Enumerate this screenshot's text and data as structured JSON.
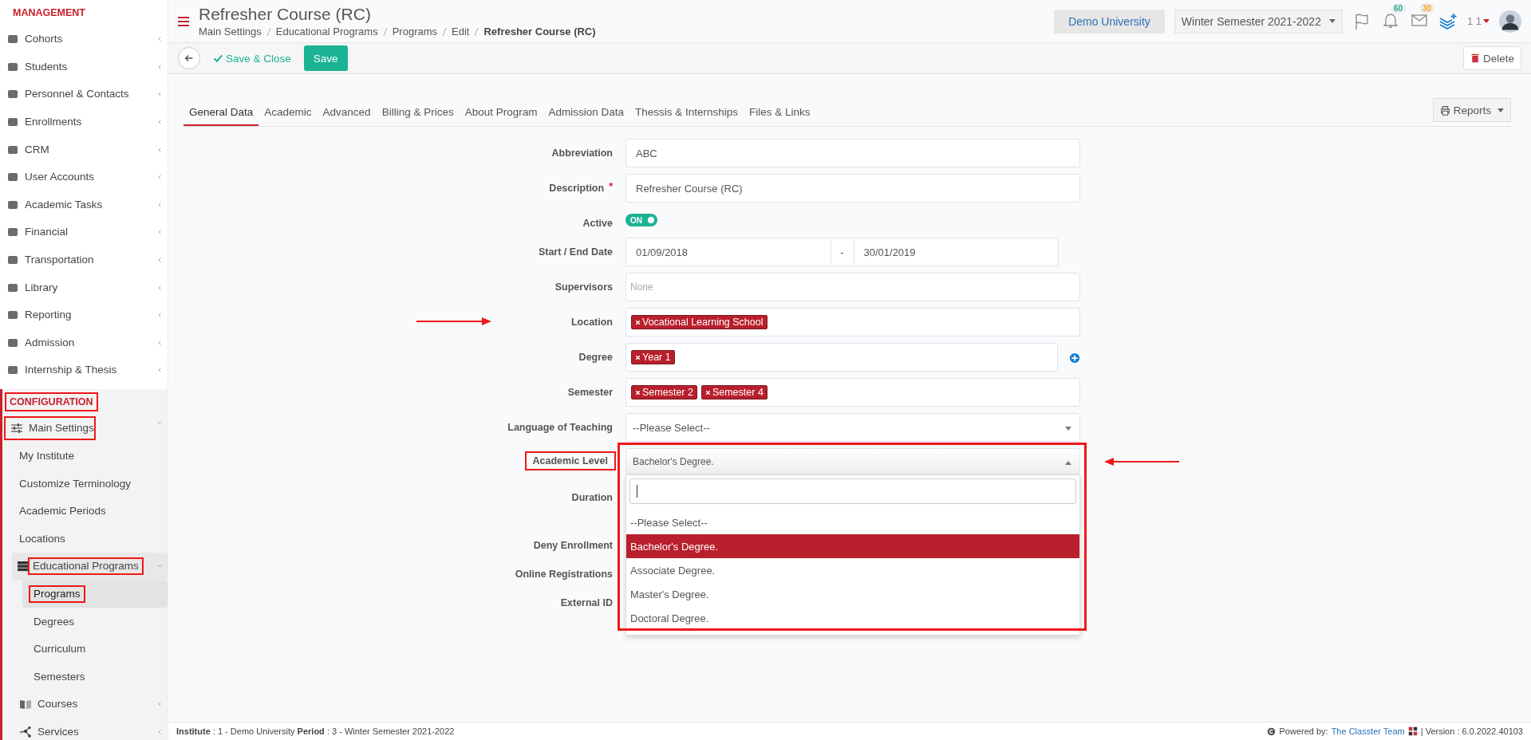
{
  "sidebar": {
    "sections": [
      {
        "title": "MANAGEMENT",
        "highlighted": false,
        "items": [
          {
            "label": "Cohorts",
            "highlighted": false,
            "selected": false,
            "expanded": false
          },
          {
            "label": "Students",
            "highlighted": false,
            "selected": false,
            "expanded": false
          },
          {
            "label": "Personnel & Contacts",
            "highlighted": false,
            "selected": false,
            "expanded": false
          },
          {
            "label": "Enrollments",
            "highlighted": false,
            "selected": false,
            "expanded": false
          },
          {
            "label": "CRM",
            "highlighted": false,
            "selected": false,
            "expanded": false
          },
          {
            "label": "User Accounts",
            "highlighted": false,
            "selected": false,
            "expanded": false
          },
          {
            "label": "Academic Tasks",
            "highlighted": false,
            "selected": false,
            "expanded": false
          },
          {
            "label": "Financial",
            "highlighted": false,
            "selected": false,
            "expanded": false
          },
          {
            "label": "Transportation",
            "highlighted": false,
            "selected": false,
            "expanded": false
          },
          {
            "label": "Library",
            "highlighted": false,
            "selected": false,
            "expanded": false
          },
          {
            "label": "Reporting",
            "highlighted": false,
            "selected": false,
            "expanded": false
          },
          {
            "label": "Admission",
            "highlighted": false,
            "selected": false,
            "expanded": false
          },
          {
            "label": "Internship & Thesis",
            "highlighted": false,
            "selected": false,
            "expanded": false
          }
        ]
      },
      {
        "title": "CONFIGURATION",
        "highlighted": true,
        "items": [
          {
            "label": "Main Settings",
            "highlighted": true,
            "selected": false,
            "expanded": true,
            "children": [
              {
                "label": "My Institute",
                "highlighted": false,
                "selected": false
              },
              {
                "label": "Customize Terminology",
                "highlighted": false,
                "selected": false
              },
              {
                "label": "Academic Periods",
                "highlighted": false,
                "selected": false
              },
              {
                "label": "Locations",
                "highlighted": false,
                "selected": false
              },
              {
                "label": "Educational Programs",
                "highlighted": true,
                "selected": false,
                "expanded": true,
                "children": [
                  {
                    "label": "Programs",
                    "highlighted": true,
                    "selected": true
                  },
                  {
                    "label": "Degrees",
                    "highlighted": false,
                    "selected": false
                  },
                  {
                    "label": "Curriculum",
                    "highlighted": false,
                    "selected": false
                  },
                  {
                    "label": "Semesters",
                    "highlighted": false,
                    "selected": false
                  }
                ]
              },
              {
                "label": "Courses",
                "highlighted": false,
                "selected": false,
                "expanded": false
              },
              {
                "label": "Services",
                "highlighted": false,
                "selected": false,
                "expanded": false
              }
            ]
          }
        ]
      }
    ]
  },
  "header": {
    "title": "Refresher Course (RC)",
    "breadcrumbs": [
      "Main Settings",
      "Educational Programs",
      "Programs",
      "Edit",
      "Refresher Course (RC)"
    ],
    "institution": "Demo University",
    "period": "Winter Semester 2021-2022",
    "notifications": "60",
    "messages": "30",
    "user": "1 1"
  },
  "toolbar": {
    "save_close": "Save & Close",
    "save": "Save",
    "delete": "Delete"
  },
  "tabs": [
    {
      "label": "General Data",
      "selected": true
    },
    {
      "label": "Academic",
      "selected": false
    },
    {
      "label": "Advanced",
      "selected": false
    },
    {
      "label": "Billing & Prices",
      "selected": false
    },
    {
      "label": "About Program",
      "selected": false
    },
    {
      "label": "Admission Data",
      "selected": false
    },
    {
      "label": "Thessis & Internships",
      "selected": false
    },
    {
      "label": "Files & Links",
      "selected": false
    }
  ],
  "reports": "Reports",
  "form": [
    {
      "kind": "text",
      "label": "Abbreviation",
      "value": "ABC"
    },
    {
      "kind": "text",
      "label": "Description",
      "required_mark": "*",
      "value": "Refresher Course (RC)"
    },
    {
      "kind": "toggle",
      "label": "Active",
      "on": true,
      "text": "ON"
    },
    {
      "kind": "daterange",
      "label": "Start / End Date",
      "start": "01/09/2018",
      "separator": "-",
      "end": "30/01/2019"
    },
    {
      "kind": "text",
      "label": "Supervisors",
      "placeholder": "None"
    },
    {
      "kind": "tags",
      "label": "Location",
      "arrow_from_left": true,
      "tags": [
        "Vocational Learning School"
      ]
    },
    {
      "kind": "tags",
      "label": "Degree",
      "add": true,
      "tags": [
        "Year 1"
      ]
    },
    {
      "kind": "tags",
      "label": "Semester",
      "tags": [
        "Semester 2",
        "Semester 4"
      ]
    },
    {
      "kind": "select",
      "label": "Language of Teaching",
      "value": "--Please Select--"
    },
    {
      "kind": "open-select",
      "label": "Academic Level",
      "highlighted": true,
      "arrow_from_right": true,
      "value": "Bachelor's Degree.",
      "options": [
        {
          "label": "--Please Select--",
          "selected": false
        },
        {
          "label": "Bachelor's Degree.",
          "selected": true
        },
        {
          "label": "Associate Degree.",
          "selected": false
        },
        {
          "label": "Master's Degree.",
          "selected": false
        },
        {
          "label": "Doctoral Degree.",
          "selected": false
        }
      ]
    },
    {
      "kind": "covered",
      "label": "Duration"
    },
    {
      "kind": "covered",
      "label": "Deny Enrollment"
    },
    {
      "kind": "covered",
      "label": "Online Registrations"
    },
    {
      "kind": "covered",
      "label": "External ID"
    }
  ],
  "footer": {
    "info": "**Institute** : 1 - Demo University **Period** : 3 - Winter Semester 2021-2022",
    "powered": "Powered by:",
    "team": "The Classter Team",
    "version": "| Version : 6.0.2022.40103"
  }
}
